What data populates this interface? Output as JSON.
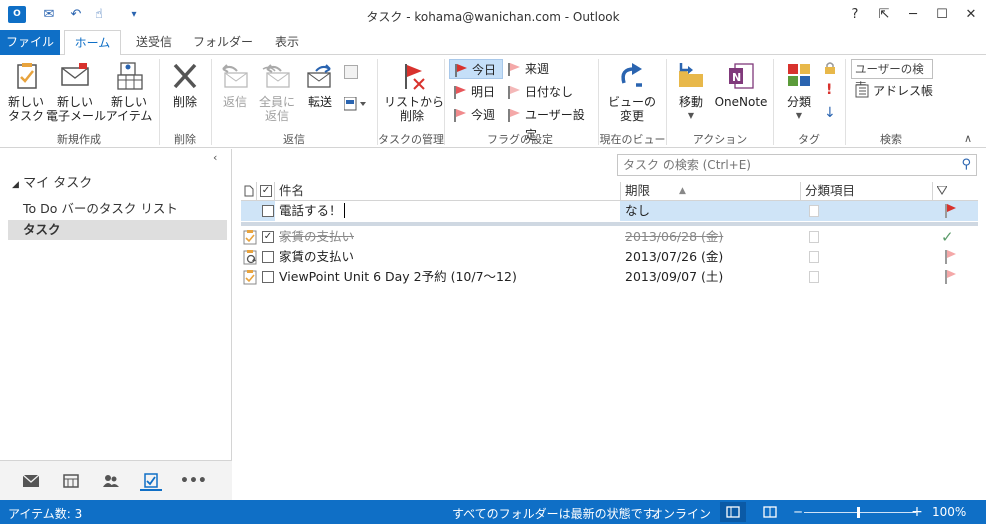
{
  "titlebar": {
    "title": "タスク - kohama@wanichan.com - Outlook",
    "help": "?",
    "restore_ribbon": "⇱",
    "minimize": "─",
    "maximize": "☐",
    "close": "✕",
    "app_icon_text": "O",
    "qa_send_receive": "✉",
    "qa_undo": "↶",
    "qa_touch": "☝",
    "qa_customize": "▾"
  },
  "tabs": [
    "ファイル",
    "ホーム",
    "送受信",
    "フォルダー",
    "表示"
  ],
  "ribbon": {
    "new_task": "新しい\nタスク",
    "new_email": "新しい\n電子メール",
    "new_items": "新しい\nアイテム",
    "group_new": "新規作成",
    "delete": "削除",
    "group_delete": "削除",
    "reply": "返信",
    "reply_all": "全員に\n返信",
    "forward": "転送",
    "group_respond": "返信",
    "remove_from_list": "リストから\n削除",
    "group_manage": "タスクの管理",
    "flag_today": "今日",
    "flag_tomorrow": "明日",
    "flag_this_week": "今週",
    "flag_next_week": "来週",
    "flag_no_date": "日付なし",
    "flag_custom": "ユーザー設定",
    "group_follow_up": "フラグの設定",
    "change_view": "ビューの\n変更",
    "group_current_view": "現在のビュー",
    "move": "移動",
    "onenote": "OneNote",
    "group_actions": "アクション",
    "categorize": "分類",
    "group_tags": "タグ",
    "search_people": "ユーザーの検索",
    "address_book": "アドレス帳",
    "group_find": "検索"
  },
  "leftpane": {
    "my_tasks": "マイ タスク",
    "folders": [
      "To Do バーのタスク リスト",
      "タスク"
    ],
    "selected_folder": "タスク"
  },
  "search": {
    "placeholder": "タスク の検索 (Ctrl+E)"
  },
  "grid": {
    "headers": {
      "subject": "件名",
      "due": "期限",
      "category": "分類項目"
    },
    "new_row": {
      "subject": "電話する！",
      "due": "なし"
    },
    "rows": [
      {
        "subject": "家賃の支払い",
        "due": "2013/06/28 (金)",
        "completed": true
      },
      {
        "subject": "家賃の支払い",
        "due": "2013/07/26 (金)",
        "completed": false
      },
      {
        "subject": "ViewPoint Unit 6 Day 2予約 (10/7～12)",
        "due": "2013/09/07 (土)",
        "completed": false
      }
    ]
  },
  "statusbar": {
    "item_count": "アイテム数: 3",
    "folder_status": "すべてのフォルダーは最新の状態です。",
    "connection": "オンライン",
    "zoom": "100%",
    "zoom_minus": "─",
    "zoom_plus": "+"
  },
  "colors": {
    "accent": "#0f6fc6",
    "flag_red": "#d8322d",
    "flag_pink": "#f4a8a8"
  }
}
